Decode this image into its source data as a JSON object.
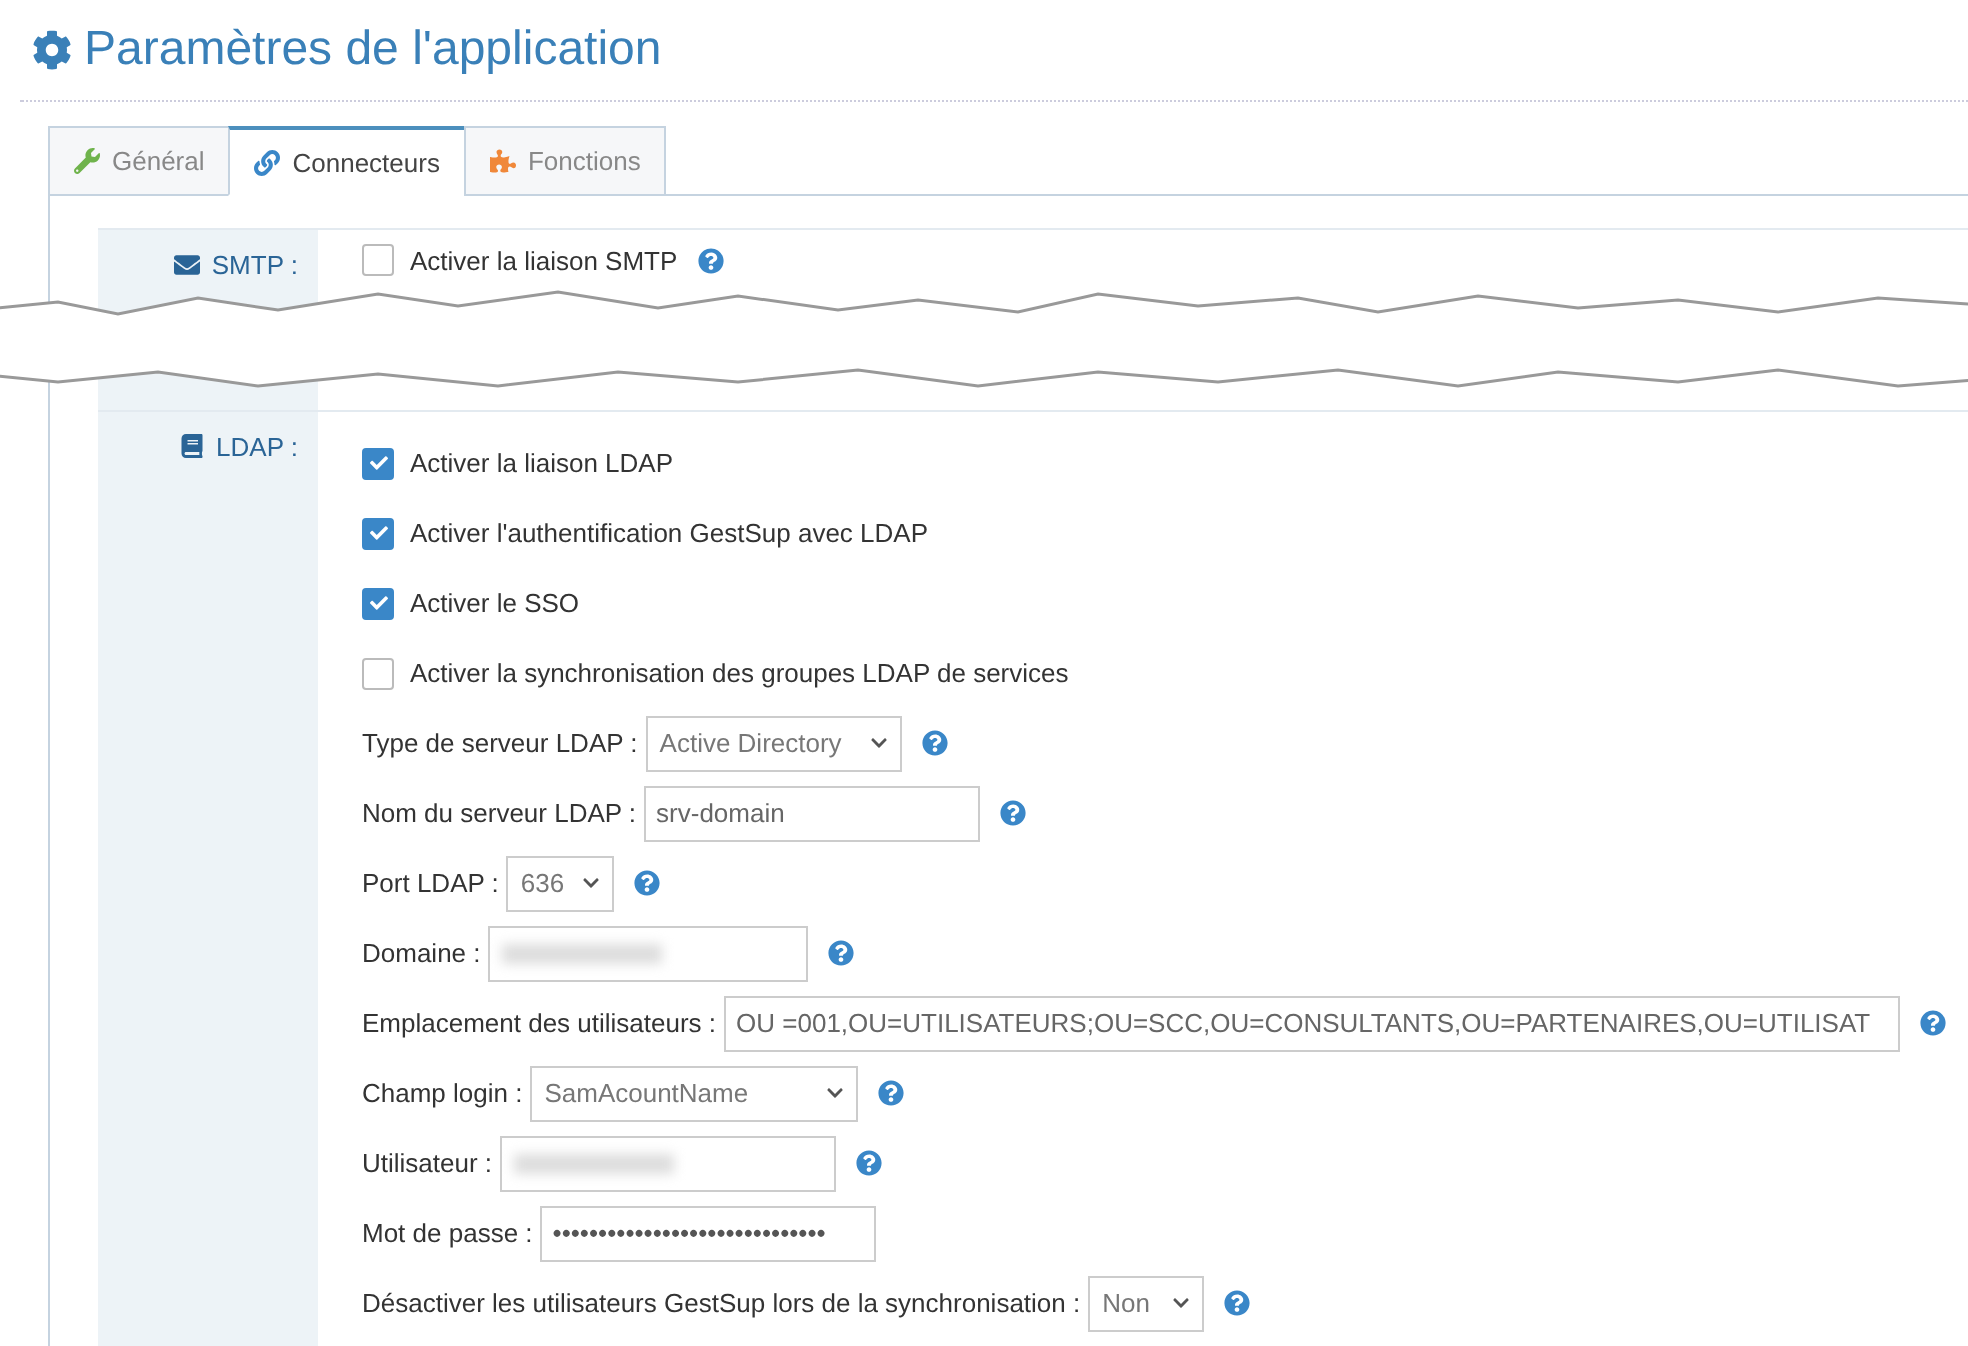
{
  "page": {
    "title": "Paramètres de l'application"
  },
  "tabs": [
    {
      "label": "Général",
      "selected": false
    },
    {
      "label": "Connecteurs",
      "selected": true
    },
    {
      "label": "Fonctions",
      "selected": false
    }
  ],
  "smtp": {
    "label": "SMTP :",
    "checkbox": {
      "label": "Activer la liaison SMTP",
      "checked": false
    }
  },
  "ldap": {
    "label": "LDAP :",
    "checkboxes": [
      {
        "label": "Activer la liaison LDAP",
        "checked": true
      },
      {
        "label": "Activer l'authentification GestSup avec LDAP",
        "checked": true
      },
      {
        "label": "Activer le SSO",
        "checked": true
      },
      {
        "label": "Activer la synchronisation des groupes LDAP de services",
        "checked": false
      }
    ],
    "fields": [
      {
        "kind": "select",
        "label": "Type de serveur LDAP :",
        "value": "Active Directory",
        "help": true
      },
      {
        "kind": "text",
        "label": "Nom du serveur LDAP :",
        "value": "srv-domain",
        "help": true
      },
      {
        "kind": "select",
        "label": "Port LDAP :",
        "value": "636",
        "help": true
      },
      {
        "kind": "blurred",
        "label": "Domaine :",
        "help": true
      },
      {
        "kind": "text",
        "label": "Emplacement des utilisateurs :",
        "value": "OU =001,OU=UTILISATEURS;OU=SCC,OU=CONSULTANTS,OU=PARTENAIRES,OU=UTILISAT",
        "help": true
      },
      {
        "kind": "select",
        "label": "Champ login :",
        "value": "SamAcountName",
        "help": true
      },
      {
        "kind": "blurred",
        "label": "Utilisateur :",
        "help": true
      },
      {
        "kind": "password",
        "label": "Mot de passe :",
        "value": "••••••••••••••••••••••••••••••",
        "help": false
      },
      {
        "kind": "select",
        "label": "Désactiver les utilisateurs GestSup lors de la synchronisation :",
        "value": "Non",
        "help": true
      }
    ]
  }
}
